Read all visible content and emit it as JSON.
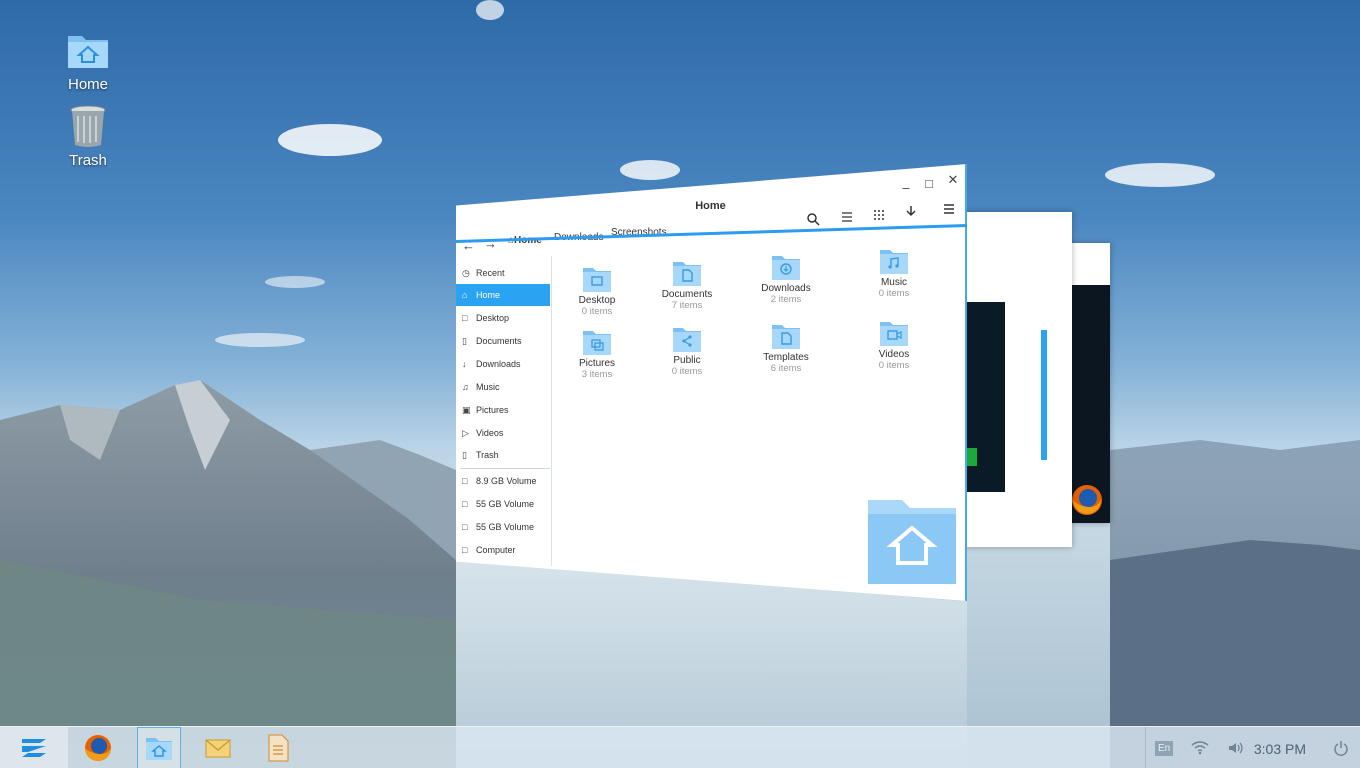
{
  "desktop": {
    "icons": [
      {
        "label": "Home",
        "icon": "home-folder-icon"
      },
      {
        "label": "Trash",
        "icon": "trash-icon"
      }
    ]
  },
  "window": {
    "title": "Home",
    "controls": {
      "minimize": "–",
      "maximize": "□",
      "close": "✕"
    },
    "nav": {
      "back": "←",
      "forward": "→"
    },
    "tabs": [
      {
        "label": "Home",
        "icon": "home-icon"
      },
      {
        "label": "Downloads"
      },
      {
        "label": "Screenshots"
      }
    ],
    "toolbar_icons": [
      "search-icon",
      "list-view-icon",
      "grid-view-icon",
      "download-icon",
      "menu-icon"
    ],
    "sidebar": [
      {
        "label": "Recent",
        "icon": "◷"
      },
      {
        "label": "Home",
        "icon": "⌂"
      },
      {
        "label": "Desktop",
        "icon": "□"
      },
      {
        "label": "Documents",
        "icon": "▯"
      },
      {
        "label": "Downloads",
        "icon": "↓"
      },
      {
        "label": "Music",
        "icon": "♫"
      },
      {
        "label": "Pictures",
        "icon": "▣"
      },
      {
        "label": "Videos",
        "icon": "▷"
      },
      {
        "label": "Trash",
        "icon": "▯"
      },
      {
        "label": "8.9 GB Volume",
        "icon": "□"
      },
      {
        "label": "55 GB Volume",
        "icon": "□"
      },
      {
        "label": "55 GB Volume",
        "icon": "□"
      },
      {
        "label": "Computer",
        "icon": "□"
      }
    ],
    "files": [
      {
        "name": "Desktop",
        "count": "0 items",
        "icon": "desktop-folder-icon"
      },
      {
        "name": "Documents",
        "count": "7 items",
        "icon": "documents-folder-icon"
      },
      {
        "name": "Downloads",
        "count": "2 items",
        "icon": "downloads-folder-icon"
      },
      {
        "name": "Music",
        "count": "0 items",
        "icon": "music-folder-icon"
      },
      {
        "name": "Pictures",
        "count": "3 items",
        "icon": "pictures-folder-icon"
      },
      {
        "name": "Public",
        "count": "0 items",
        "icon": "public-folder-icon"
      },
      {
        "name": "Templates",
        "count": "6 items",
        "icon": "templates-folder-icon"
      },
      {
        "name": "Videos",
        "count": "0 items",
        "icon": "videos-folder-icon"
      }
    ]
  },
  "taskbar": {
    "apps": [
      "zorin-menu-icon",
      "firefox-icon",
      "files-icon",
      "mail-icon",
      "document-viewer-icon"
    ],
    "tray": {
      "keyboard": "En",
      "wifi_icon": "wifi-icon",
      "volume_icon": "volume-icon",
      "power_icon": "power-icon"
    },
    "clock": "3:03 PM"
  },
  "colors": {
    "accent": "#2aa3f2",
    "folder": "#8cc8f5",
    "taskbar": "#dae8f2"
  }
}
